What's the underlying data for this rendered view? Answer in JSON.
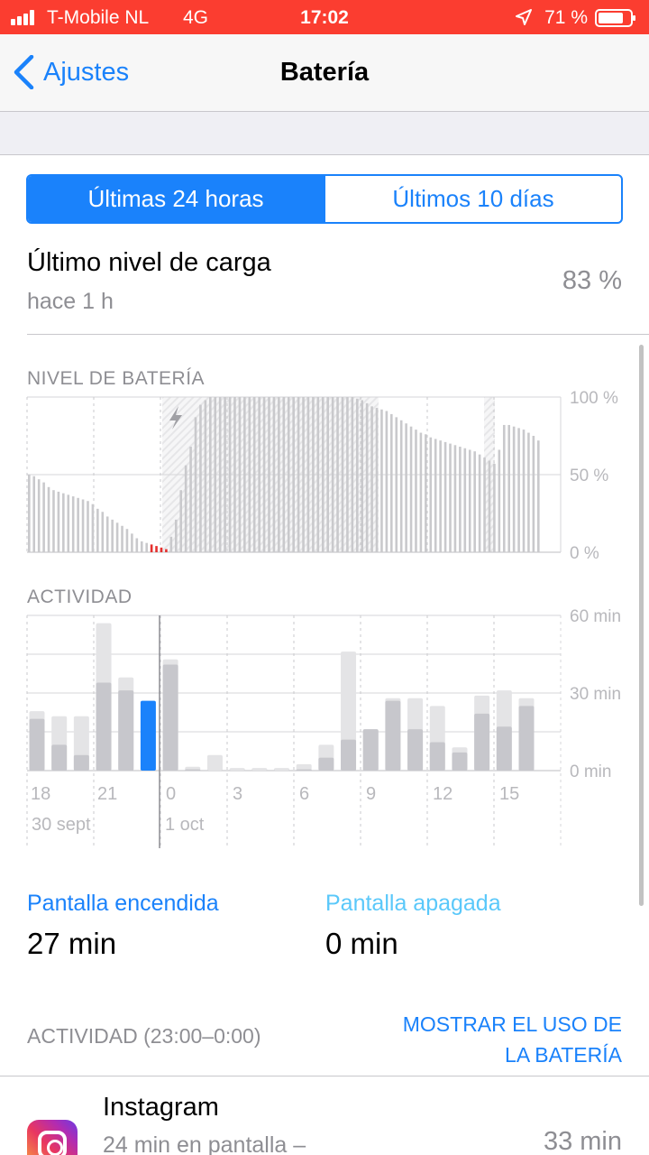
{
  "status_bar": {
    "carrier": "T-Mobile NL",
    "network": "4G",
    "time": "17:02",
    "battery_percent": "71 %",
    "icons": [
      "signal-icon",
      "location-arrow-icon",
      "battery-icon"
    ]
  },
  "nav": {
    "back_label": "Ajustes",
    "title": "Batería"
  },
  "segments": [
    {
      "label": "Últimas 24 horas",
      "active": true
    },
    {
      "label": "Últimos 10 días",
      "active": false
    }
  ],
  "last_charge": {
    "title": "Último nivel de carga",
    "subtitle": "hace 1 h",
    "value": "83 %"
  },
  "colors": {
    "accent": "#1a82fb",
    "status_bar": "#fb3d30",
    "screen_off": "#5ac8fa",
    "low_battery": "#e5302e",
    "bar_dark": "#c7c7cc",
    "bar_light": "#e4e4e6"
  },
  "chart_data": [
    {
      "type": "bar",
      "title": "NIVEL DE BATERÍA",
      "y_tick_labels": [
        "100 %",
        "50 %",
        "0 %"
      ],
      "ylim": [
        0,
        100
      ],
      "grid": true,
      "charging_marker": "lightning-icon",
      "values": [
        50,
        49,
        47,
        45,
        42,
        40,
        39,
        38,
        37,
        36,
        35,
        34,
        33,
        31,
        28,
        26,
        23,
        21,
        19,
        17,
        15,
        12,
        9,
        7,
        6,
        5,
        4,
        3,
        2,
        10,
        21,
        40,
        56,
        68,
        87,
        95,
        98,
        100,
        100,
        100,
        100,
        100,
        100,
        100,
        100,
        100,
        100,
        100,
        100,
        100,
        100,
        100,
        100,
        100,
        100,
        100,
        100,
        100,
        100,
        100,
        100,
        100,
        100,
        100,
        100,
        100,
        100,
        99,
        98,
        96,
        94,
        93,
        92,
        91,
        89,
        87,
        85,
        83,
        81,
        79,
        77,
        76,
        74,
        73,
        72,
        71,
        70,
        69,
        68,
        67,
        66,
        65,
        63,
        61,
        59,
        57,
        66,
        82,
        82,
        81,
        80,
        79,
        77,
        75,
        72
      ],
      "low_bar_indices": [
        25,
        26,
        27,
        28
      ]
    },
    {
      "type": "bar",
      "title": "ACTIVIDAD",
      "y_tick_labels": [
        "60 min",
        "30 min",
        "0 min"
      ],
      "ylim": [
        0,
        60
      ],
      "grid": true,
      "x_tick_labels": [
        "18",
        "21",
        "0",
        "3",
        "6",
        "9",
        "12",
        "15"
      ],
      "date_labels": [
        "30 sept",
        "1 oct"
      ],
      "series": [
        {
          "values": [
            20,
            10,
            6,
            34,
            31,
            27,
            41,
            0.5,
            0,
            0,
            0,
            0,
            0.5,
            5,
            12,
            16,
            27,
            16,
            11,
            7,
            22,
            17,
            25
          ]
        },
        {
          "values": [
            3,
            11,
            15,
            23,
            5,
            0,
            2,
            1,
            6,
            1,
            1,
            1,
            2,
            5,
            34,
            0,
            1,
            12,
            14,
            2,
            7,
            14,
            3
          ]
        }
      ],
      "selected_index": 5
    }
  ],
  "screen": {
    "on_label": "Pantalla encendida",
    "on_value": "27 min",
    "off_label": "Pantalla apagada",
    "off_value": "0 min"
  },
  "activity": {
    "header": "ACTIVIDAD (23:00–0:00)",
    "show_usage_line1": "MOSTRAR EL USO DE",
    "show_usage_line2": "LA BATERÍA"
  },
  "apps": [
    {
      "name": "Instagram",
      "detail": "24 min en pantalla –",
      "usage": "33 min",
      "icon": "instagram-icon"
    }
  ]
}
